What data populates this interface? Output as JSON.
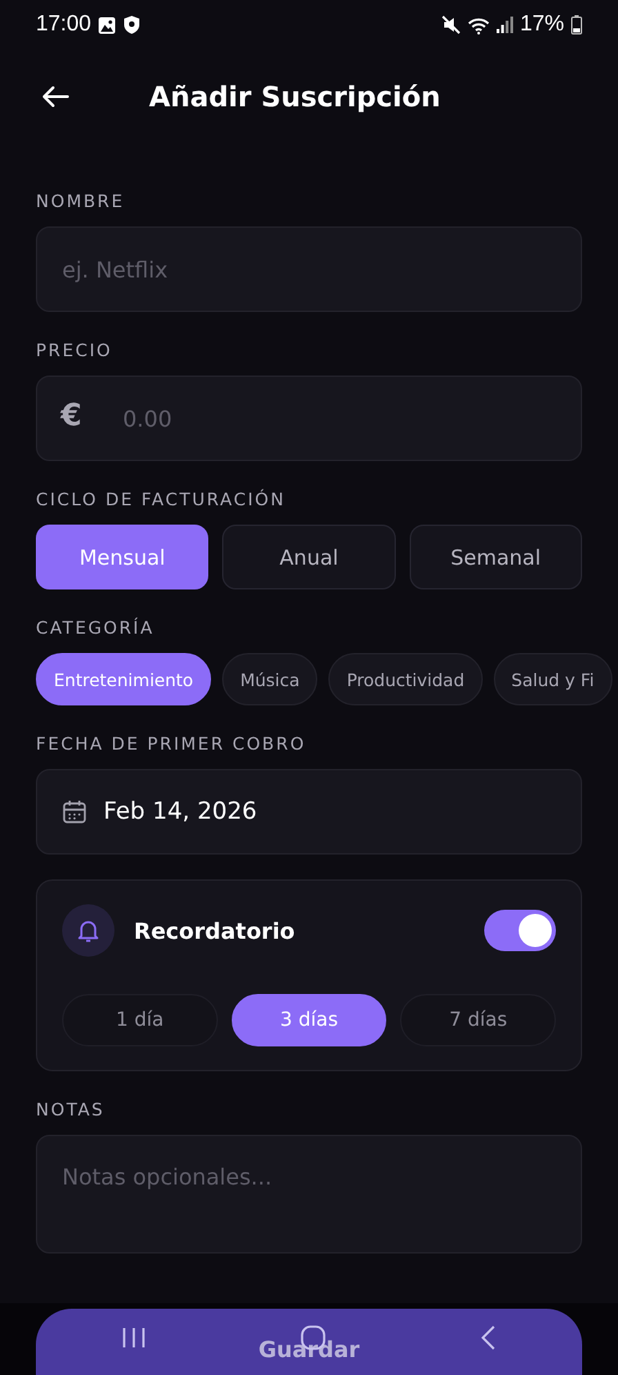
{
  "status_bar": {
    "time": "17:00",
    "battery": "17%"
  },
  "header": {
    "title": "Añadir Suscripción"
  },
  "name": {
    "label": "NOMBRE",
    "placeholder": "ej. Netflix"
  },
  "price": {
    "label": "PRECIO",
    "currency": "€",
    "placeholder": "0.00"
  },
  "billing": {
    "label": "CICLO DE FACTURACIÓN",
    "options": [
      {
        "label": "Mensual",
        "selected": true
      },
      {
        "label": "Anual",
        "selected": false
      },
      {
        "label": "Semanal",
        "selected": false
      }
    ]
  },
  "category": {
    "label": "CATEGORÍA",
    "options": [
      {
        "label": "Entretenimiento",
        "selected": true
      },
      {
        "label": "Música",
        "selected": false
      },
      {
        "label": "Productividad",
        "selected": false
      },
      {
        "label": "Salud y Fi",
        "selected": false
      }
    ]
  },
  "first_charge": {
    "label": "FECHA DE PRIMER COBRO",
    "value": "Feb 14, 2026"
  },
  "reminder": {
    "title": "Recordatorio",
    "on": true,
    "options": [
      {
        "label": "1 día",
        "selected": false
      },
      {
        "label": "3 días",
        "selected": true
      },
      {
        "label": "7 días",
        "selected": false
      }
    ]
  },
  "notes": {
    "label": "NOTAS",
    "placeholder": "Notas opcionales..."
  },
  "save_button": "Guardar"
}
